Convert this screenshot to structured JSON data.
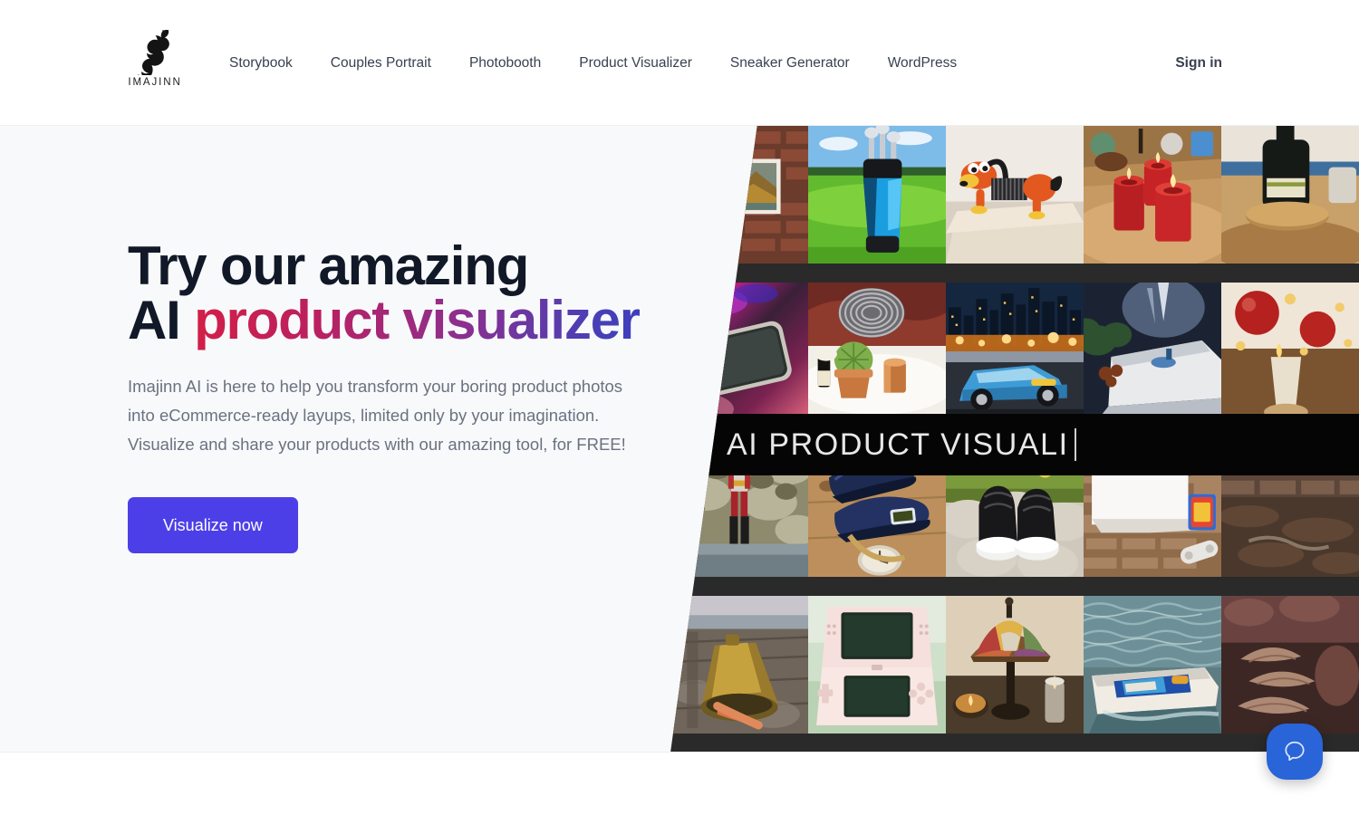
{
  "header": {
    "logo": {
      "wordmark": "IMAJINN",
      "icon": "genie-logo-icon"
    },
    "nav": [
      {
        "label": "Storybook"
      },
      {
        "label": "Couples Portrait"
      },
      {
        "label": "Photobooth"
      },
      {
        "label": "Product Visualizer"
      },
      {
        "label": "Sneaker Generator"
      },
      {
        "label": "WordPress"
      }
    ],
    "signin_label": "Sign in"
  },
  "hero": {
    "headline_line1": "Try our amazing",
    "headline_line2_plain": "AI ",
    "headline_gradient": "product visualizer",
    "paragraph": "Imajinn AI is here to help you transform your boring product photos into eCommerce-ready layups, limited only by your imagination. Visualize and share your products with our amazing tool, for FREE!",
    "cta_label": "Visualize now"
  },
  "collage": {
    "banner_text": "AI PRODUCT VISUALI",
    "tiles": [
      {
        "name": "framed-landscape-painting-on-brick-wall"
      },
      {
        "name": "golf-club-bag-on-fairway"
      },
      {
        "name": "slinky-dog-toy-on-pedestal"
      },
      {
        "name": "three-red-pillar-candles"
      },
      {
        "name": "wine-bottle-on-wooden-tray"
      },
      {
        "name": "smartphone-on-neon-lit-surface"
      },
      {
        "name": "cactus-planter-with-copper-cup"
      },
      {
        "name": "blue-muscle-car-before-city-skyline"
      },
      {
        "name": "white-speedboat-at-night"
      },
      {
        "name": "christmas-ornaments-and-candle"
      },
      {
        "name": "action-figure-on-stone-wall"
      },
      {
        "name": "navy-canvas-sneakers-on-wood"
      },
      {
        "name": "black-and-white-basketball-shoes"
      },
      {
        "name": "game-console-box-on-brick-floor"
      },
      {
        "name": "dark-brick-alley-detail"
      },
      {
        "name": "brass-bell-on-rustic-planks"
      },
      {
        "name": "pink-handheld-game-console"
      },
      {
        "name": "stained-glass-tiffany-lamp"
      },
      {
        "name": "racing-speedboat-on-water"
      },
      {
        "name": "ornate-shell-decor"
      }
    ]
  },
  "widgets": {
    "chat_beacon": {
      "icon": "chat-bubble-icon"
    }
  },
  "colors": {
    "cta": "#4d3fe8",
    "gradient_start": "#d31f46",
    "gradient_end": "#3d3fbe",
    "beacon": "#2964d8",
    "hero_bg": "#f8f9fb",
    "heading": "#111827",
    "body_text": "#6a7280"
  }
}
